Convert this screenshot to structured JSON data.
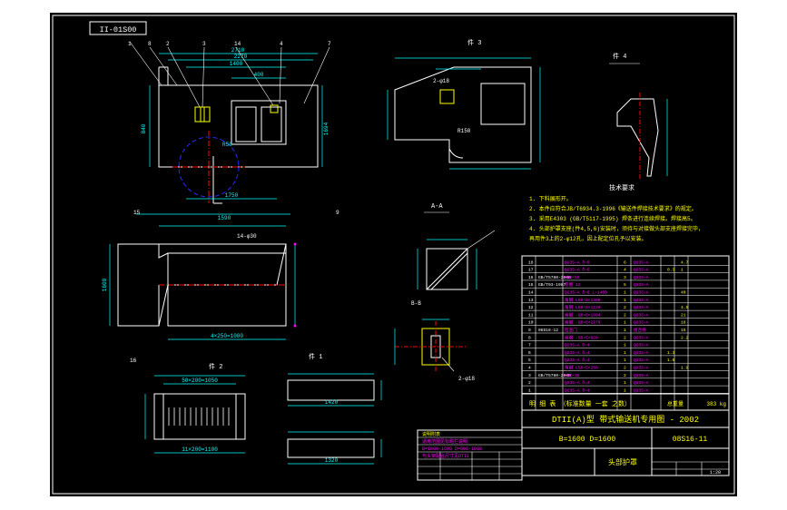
{
  "drawing": {
    "code_box": "II-01S00",
    "title_line": "DTII(A)型  带式输送机专用图 - 2002",
    "dims_line": "B=1600 D=1600",
    "drawing_no": "08S16-11",
    "part_name": "头部护罩",
    "weight": "383 kg",
    "bom_footer": "明  细  表  （标准数量 一套 之数）",
    "bom_footer_right": "总重量",
    "scale": "1:20"
  },
  "tech_requirements": {
    "title": "技术要求",
    "items": [
      "1. 下料展形开。",
      "2. 本件应符合JB/T6934.3-1996《输送件焊接技术要求》的规定。",
      "3. 采用E4303 (GB/T5117-1995) 焊条进行连续焊接。焊接高5。",
      "4. 头部护罩支座(件4,5,6)安装时，须待与对接做头部支座焊接完毕，",
      "   再用件3上的2-φ12孔，因上配定位孔予以安装。"
    ]
  },
  "views": {
    "view_a": "件 3",
    "view_b": "件 1",
    "view_c": "件 2",
    "section": "A-A",
    "section_b": "B-B",
    "detail": "件 4"
  },
  "dims": {
    "d2710": "2710",
    "d2270": "2270",
    "d1400": "1400",
    "d1590": "1590",
    "d1694": "1694",
    "d1750": "1750",
    "d840": "840",
    "d400": "400",
    "d250": "250",
    "d1600": "1600",
    "dR50": "R50",
    "d14": "14-φ30",
    "d2x": "2-φ18",
    "d50": "50×200=1050",
    "d11": "11×200=1100",
    "d25": "25",
    "d150": "150",
    "d2": "2-φ18",
    "d1420": "1420",
    "d1320": "1320",
    "d4": "4×250=1000"
  },
  "bom_rows": [
    [
      "18",
      "",
      "Q235-A δ=6",
      "6",
      "Q235-A",
      "",
      "4.7"
    ],
    [
      "17",
      "",
      "Q235-A δ=6",
      "4",
      "Q235-A",
      "0.3",
      "1"
    ],
    [
      "16",
      "GB/T5780-2000",
      "M12×50",
      "3",
      "Q235-A",
      "",
      ""
    ],
    [
      "15",
      "GB/T93-1987",
      "垫圈 12",
      "5",
      "Q235-A",
      "",
      ""
    ],
    [
      "14",
      "",
      "Q235-A δ=6 L=1400",
      "1",
      "Q235-A",
      "",
      "40"
    ],
    [
      "13",
      "",
      "角钢 L50×5×1400",
      "1",
      "Q235-A",
      "",
      ""
    ],
    [
      "12",
      "",
      "角钢 L50×5×1230",
      "2",
      "Q235-A",
      "",
      "4.5"
    ],
    [
      "11",
      "",
      "扁钢 -60×6×1694",
      "2",
      "Q235-A",
      "",
      "21"
    ],
    [
      "10",
      "",
      "扁钢 -60×6×2270",
      "1",
      "Q235-A",
      "",
      "18"
    ],
    [
      "9",
      "08S16-12",
      "检查门",
      "1",
      "组合件",
      "",
      "15"
    ],
    [
      "8",
      "",
      "扁钢 -50×5×620",
      "2",
      "Q235-A",
      "",
      "2.2"
    ],
    [
      "7",
      "",
      "Q235-A δ=4",
      "1",
      "Q235-A",
      "",
      ""
    ],
    [
      "6",
      "",
      "Q235-A δ=4",
      "1",
      "Q235-A",
      "1.3",
      ""
    ],
    [
      "5",
      "",
      "Q235-A δ=4",
      "1",
      "Q235-A",
      "1.6",
      ""
    ],
    [
      "4",
      "",
      "角钢 L50×5×250",
      "2",
      "Q235-A",
      "",
      "1.9"
    ],
    [
      "3",
      "GB/T5780-2000",
      "M12×35",
      "2",
      "Q235-A",
      "",
      ""
    ],
    [
      "2",
      "",
      "Q235-A δ=4",
      "1",
      "Q235-A",
      "",
      ""
    ],
    [
      "1",
      "",
      "Q235-A δ=4",
      "1",
      "Q235-A",
      "",
      ""
    ]
  ],
  "bom_header": [
    "序号",
    "代号",
    "名称",
    "数量",
    "材料",
    "单重",
    "总重"
  ],
  "notes_box": {
    "title": "说明附表",
    "rows": [
      "适用范围见标题栏说明",
      "B=1000-1600 D=800-1600",
      "与头架配合尺寸见DTII",
      "",
      ""
    ]
  },
  "colors": {
    "outline": "#ffffff",
    "dim": "#00ffff",
    "label": "#ffff00",
    "table": "#ffffff",
    "text_mag": "#ff00ff",
    "text_yellow": "#ffff00",
    "center": "#ff0000",
    "circle": "#2a2aff",
    "green": "#00ff00"
  }
}
